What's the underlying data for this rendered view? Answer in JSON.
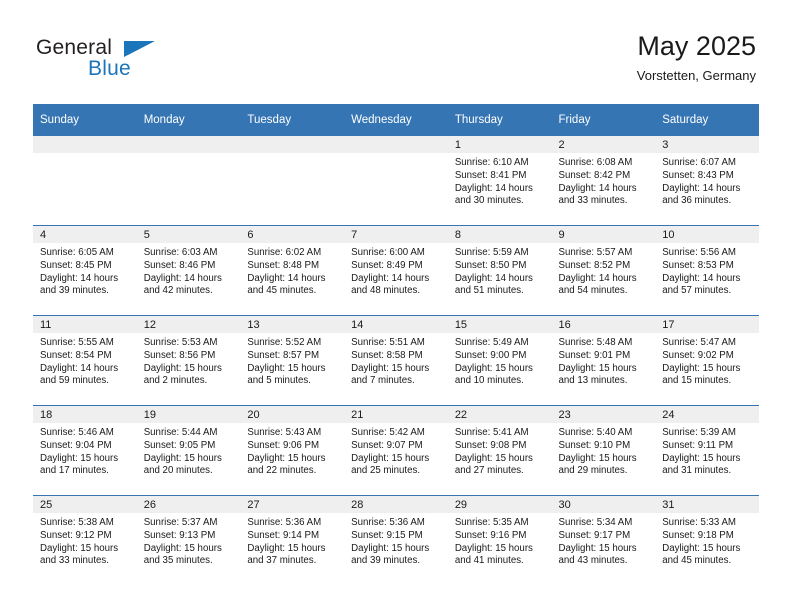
{
  "brand": {
    "name_primary": "General",
    "name_secondary": "Blue",
    "logo_icon": "triangle-icon",
    "primary_color": "#1b75bb",
    "text_color": "#231f20"
  },
  "header": {
    "title": "May 2025",
    "location": "Vorstetten, Germany"
  },
  "calendar": {
    "header_bg": "#3575b4",
    "daynum_bg": "#efefef",
    "weekdays": [
      "Sunday",
      "Monday",
      "Tuesday",
      "Wednesday",
      "Thursday",
      "Friday",
      "Saturday"
    ],
    "weeks": [
      [
        {
          "day": "",
          "empty": true
        },
        {
          "day": "",
          "empty": true
        },
        {
          "day": "",
          "empty": true
        },
        {
          "day": "",
          "empty": true
        },
        {
          "day": "1",
          "sunrise": "Sunrise: 6:10 AM",
          "sunset": "Sunset: 8:41 PM",
          "daylight": "Daylight: 14 hours and 30 minutes."
        },
        {
          "day": "2",
          "sunrise": "Sunrise: 6:08 AM",
          "sunset": "Sunset: 8:42 PM",
          "daylight": "Daylight: 14 hours and 33 minutes."
        },
        {
          "day": "3",
          "sunrise": "Sunrise: 6:07 AM",
          "sunset": "Sunset: 8:43 PM",
          "daylight": "Daylight: 14 hours and 36 minutes."
        }
      ],
      [
        {
          "day": "4",
          "sunrise": "Sunrise: 6:05 AM",
          "sunset": "Sunset: 8:45 PM",
          "daylight": "Daylight: 14 hours and 39 minutes."
        },
        {
          "day": "5",
          "sunrise": "Sunrise: 6:03 AM",
          "sunset": "Sunset: 8:46 PM",
          "daylight": "Daylight: 14 hours and 42 minutes."
        },
        {
          "day": "6",
          "sunrise": "Sunrise: 6:02 AM",
          "sunset": "Sunset: 8:48 PM",
          "daylight": "Daylight: 14 hours and 45 minutes."
        },
        {
          "day": "7",
          "sunrise": "Sunrise: 6:00 AM",
          "sunset": "Sunset: 8:49 PM",
          "daylight": "Daylight: 14 hours and 48 minutes."
        },
        {
          "day": "8",
          "sunrise": "Sunrise: 5:59 AM",
          "sunset": "Sunset: 8:50 PM",
          "daylight": "Daylight: 14 hours and 51 minutes."
        },
        {
          "day": "9",
          "sunrise": "Sunrise: 5:57 AM",
          "sunset": "Sunset: 8:52 PM",
          "daylight": "Daylight: 14 hours and 54 minutes."
        },
        {
          "day": "10",
          "sunrise": "Sunrise: 5:56 AM",
          "sunset": "Sunset: 8:53 PM",
          "daylight": "Daylight: 14 hours and 57 minutes."
        }
      ],
      [
        {
          "day": "11",
          "sunrise": "Sunrise: 5:55 AM",
          "sunset": "Sunset: 8:54 PM",
          "daylight": "Daylight: 14 hours and 59 minutes."
        },
        {
          "day": "12",
          "sunrise": "Sunrise: 5:53 AM",
          "sunset": "Sunset: 8:56 PM",
          "daylight": "Daylight: 15 hours and 2 minutes."
        },
        {
          "day": "13",
          "sunrise": "Sunrise: 5:52 AM",
          "sunset": "Sunset: 8:57 PM",
          "daylight": "Daylight: 15 hours and 5 minutes."
        },
        {
          "day": "14",
          "sunrise": "Sunrise: 5:51 AM",
          "sunset": "Sunset: 8:58 PM",
          "daylight": "Daylight: 15 hours and 7 minutes."
        },
        {
          "day": "15",
          "sunrise": "Sunrise: 5:49 AM",
          "sunset": "Sunset: 9:00 PM",
          "daylight": "Daylight: 15 hours and 10 minutes."
        },
        {
          "day": "16",
          "sunrise": "Sunrise: 5:48 AM",
          "sunset": "Sunset: 9:01 PM",
          "daylight": "Daylight: 15 hours and 13 minutes."
        },
        {
          "day": "17",
          "sunrise": "Sunrise: 5:47 AM",
          "sunset": "Sunset: 9:02 PM",
          "daylight": "Daylight: 15 hours and 15 minutes."
        }
      ],
      [
        {
          "day": "18",
          "sunrise": "Sunrise: 5:46 AM",
          "sunset": "Sunset: 9:04 PM",
          "daylight": "Daylight: 15 hours and 17 minutes."
        },
        {
          "day": "19",
          "sunrise": "Sunrise: 5:44 AM",
          "sunset": "Sunset: 9:05 PM",
          "daylight": "Daylight: 15 hours and 20 minutes."
        },
        {
          "day": "20",
          "sunrise": "Sunrise: 5:43 AM",
          "sunset": "Sunset: 9:06 PM",
          "daylight": "Daylight: 15 hours and 22 minutes."
        },
        {
          "day": "21",
          "sunrise": "Sunrise: 5:42 AM",
          "sunset": "Sunset: 9:07 PM",
          "daylight": "Daylight: 15 hours and 25 minutes."
        },
        {
          "day": "22",
          "sunrise": "Sunrise: 5:41 AM",
          "sunset": "Sunset: 9:08 PM",
          "daylight": "Daylight: 15 hours and 27 minutes."
        },
        {
          "day": "23",
          "sunrise": "Sunrise: 5:40 AM",
          "sunset": "Sunset: 9:10 PM",
          "daylight": "Daylight: 15 hours and 29 minutes."
        },
        {
          "day": "24",
          "sunrise": "Sunrise: 5:39 AM",
          "sunset": "Sunset: 9:11 PM",
          "daylight": "Daylight: 15 hours and 31 minutes."
        }
      ],
      [
        {
          "day": "25",
          "sunrise": "Sunrise: 5:38 AM",
          "sunset": "Sunset: 9:12 PM",
          "daylight": "Daylight: 15 hours and 33 minutes."
        },
        {
          "day": "26",
          "sunrise": "Sunrise: 5:37 AM",
          "sunset": "Sunset: 9:13 PM",
          "daylight": "Daylight: 15 hours and 35 minutes."
        },
        {
          "day": "27",
          "sunrise": "Sunrise: 5:36 AM",
          "sunset": "Sunset: 9:14 PM",
          "daylight": "Daylight: 15 hours and 37 minutes."
        },
        {
          "day": "28",
          "sunrise": "Sunrise: 5:36 AM",
          "sunset": "Sunset: 9:15 PM",
          "daylight": "Daylight: 15 hours and 39 minutes."
        },
        {
          "day": "29",
          "sunrise": "Sunrise: 5:35 AM",
          "sunset": "Sunset: 9:16 PM",
          "daylight": "Daylight: 15 hours and 41 minutes."
        },
        {
          "day": "30",
          "sunrise": "Sunrise: 5:34 AM",
          "sunset": "Sunset: 9:17 PM",
          "daylight": "Daylight: 15 hours and 43 minutes."
        },
        {
          "day": "31",
          "sunrise": "Sunrise: 5:33 AM",
          "sunset": "Sunset: 9:18 PM",
          "daylight": "Daylight: 15 hours and 45 minutes."
        }
      ]
    ]
  }
}
